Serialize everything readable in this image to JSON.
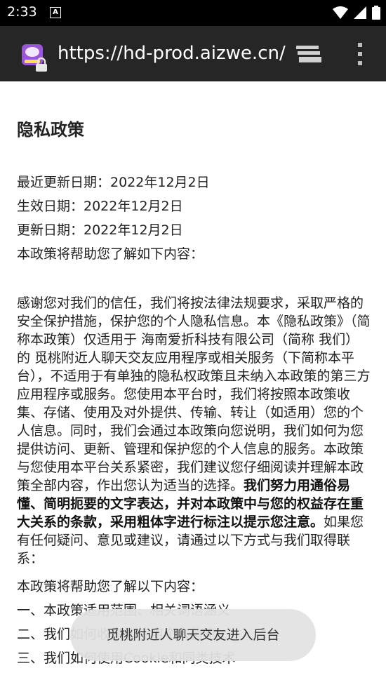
{
  "status_bar": {
    "time": "2:33",
    "notification_letter": "A"
  },
  "browser": {
    "url": "https://hd-prod.aizwe.cn/"
  },
  "page": {
    "title": "隐私政策",
    "last_updated": "最近更新日期：2022年12月2日",
    "effective_date": "生效日期：2022年12月2日",
    "update_date": "更新日期：2022年12月2日",
    "intro": "本政策将帮助您了解如下内容：",
    "body_normal": "感谢您对我们的信任，我们将按法律法规要求，采取严格的安全保护措施，保护您的个人隐私信息。本《隐私政策》（简称本政策）仅适用于 海南爱折科技有限公司（简称 我们）的 觅桃附近人聊天交友应用程序或相关服务（下简称本平台），不适用于有单独的隐私权政策且未纳入本政策的第三方应用程序或服务。您使用本平台时，我们将按照本政策收集、存储、使用及对外提供、传输、转让（如适用）您的个人信息。同时，我们会通过本政策向您说明，我们如何为您提供访问、更新、管理和保护您的个人信息的服务。本政策与您使用本平台关系紧密，我们建议您仔细阅读并理解本政策全部内容，作出您认为适当的选择。",
    "body_bold": "我们努力用通俗易懂、简明扼要的文字表达，并对本政策中与您的权益存在重大关系的条款，采用粗体字进行标注以提示您注意。",
    "body_tail": "如果您有任何疑问、意见或建议，请通过以下方式与我们取得联系：",
    "toc_intro": "本政策将帮助您了解以下内容：",
    "toc": [
      "一、本政策适用范围、相关词语涵义",
      "二、我们如何收集和使用个人信息",
      "三、我们如何使用Cookie和同类技术"
    ]
  },
  "toast": {
    "text": "觅桃附近人聊天交友进入后台"
  }
}
